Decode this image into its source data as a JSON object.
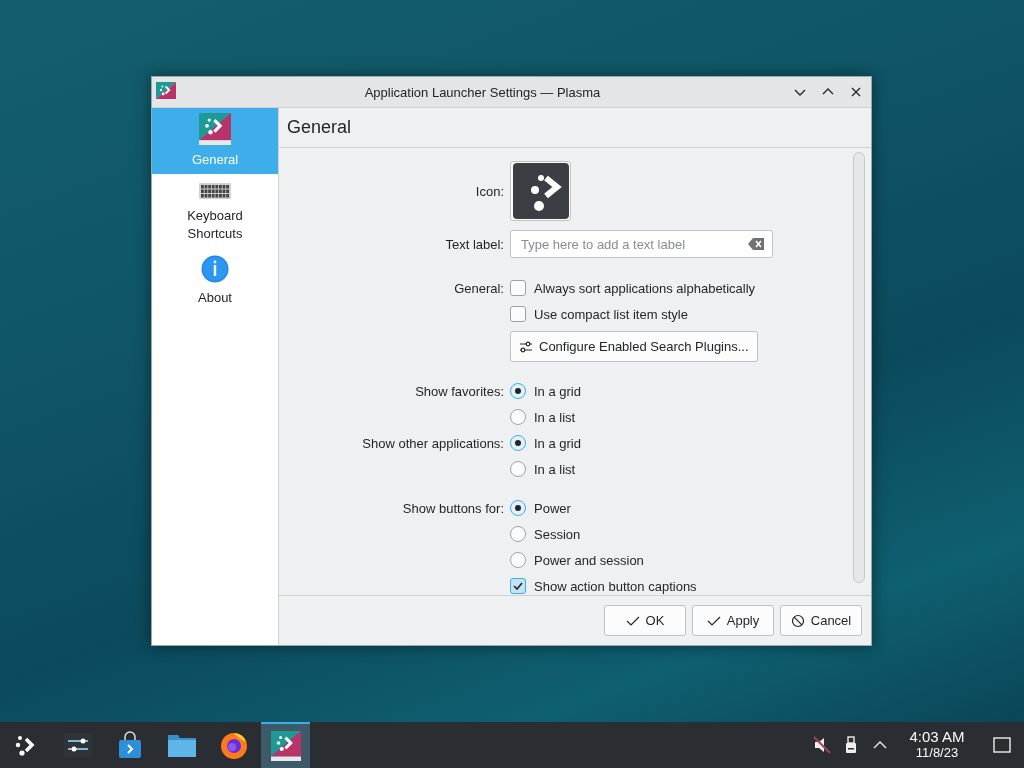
{
  "window": {
    "title": "Application Launcher Settings — Plasma"
  },
  "sidebar": {
    "items": [
      {
        "kind": "launcher",
        "label": "General",
        "selected": true
      },
      {
        "kind": "keyboard",
        "label": "Keyboard Shortcuts",
        "selected": false
      },
      {
        "kind": "info",
        "label": "About",
        "selected": false
      }
    ]
  },
  "page": {
    "title": "General"
  },
  "form": {
    "icon": {
      "label": "Icon:"
    },
    "text_label": {
      "label": "Text label:",
      "placeholder": "Type here to add a text label"
    },
    "general": {
      "label": "General:",
      "options": [
        {
          "label": "Always sort applications alphabetically",
          "checked": false
        },
        {
          "label": "Use compact list item style",
          "checked": false
        }
      ],
      "button": "Configure Enabled Search Plugins..."
    },
    "show_favorites": {
      "label": "Show favorites:",
      "options": [
        {
          "label": "In a grid",
          "selected": true
        },
        {
          "label": "In a list",
          "selected": false
        }
      ]
    },
    "show_other_applications": {
      "label": "Show other applications:",
      "options": [
        {
          "label": "In a grid",
          "selected": true
        },
        {
          "label": "In a list",
          "selected": false
        }
      ]
    },
    "show_buttons_for": {
      "label": "Show buttons for:",
      "options": [
        {
          "label": "Power",
          "selected": true
        },
        {
          "label": "Session",
          "selected": false
        },
        {
          "label": "Power and session",
          "selected": false
        }
      ],
      "captions": {
        "label": "Show action button captions",
        "checked": true
      }
    }
  },
  "buttons": [
    {
      "kind": "ok",
      "label": "OK"
    },
    {
      "kind": "apply",
      "label": "Apply"
    },
    {
      "kind": "cancel",
      "label": "Cancel"
    }
  ],
  "taskbar": {
    "items": [
      {
        "kind": "launcher",
        "selected": false
      },
      {
        "kind": "settings",
        "selected": false
      },
      {
        "kind": "store",
        "selected": false
      },
      {
        "kind": "files",
        "selected": false
      },
      {
        "kind": "browser",
        "selected": false
      },
      {
        "kind": "launcher-settings",
        "selected": true
      }
    ],
    "tray": [
      {
        "kind": "muted-speaker"
      },
      {
        "kind": "usb"
      },
      {
        "kind": "expand"
      }
    ],
    "clock": {
      "time": "4:03 AM",
      "date": "11/8/23"
    }
  }
}
